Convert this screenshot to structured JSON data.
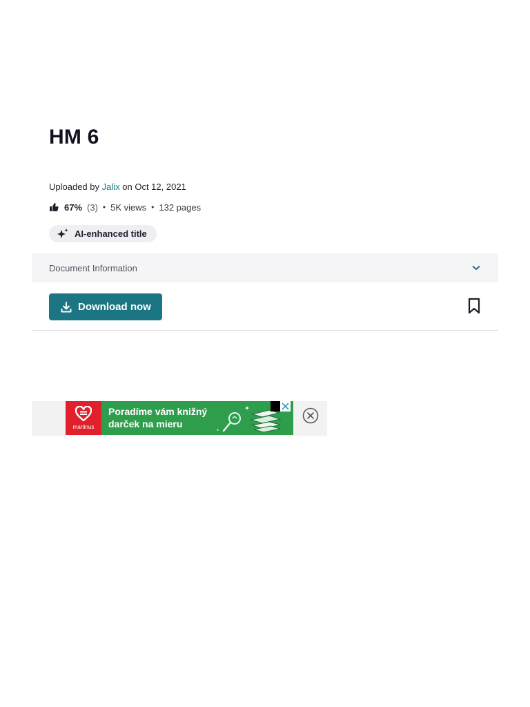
{
  "document": {
    "title": "HM 6",
    "uploaded_prefix": "Uploaded by",
    "author": "Jalix",
    "date_text": "on Oct 12, 2021"
  },
  "stats": {
    "rating_percent": "67%",
    "rating_count": "(3)",
    "separator": "•",
    "views": "5K views",
    "pages": "132 pages"
  },
  "ai_badge": {
    "label": "AI-enhanced title"
  },
  "doc_info": {
    "label": "Document Information"
  },
  "actions": {
    "download_label": "Download now"
  },
  "ad": {
    "brand": "martinus",
    "headline_line1": "Poradíme vám knižný",
    "headline_line2": "darček na mieru"
  },
  "icons": {
    "thumb": "thumbs-up-icon",
    "ai": "sparkle-icon",
    "chevron": "chevron-down-icon",
    "download": "download-icon",
    "bookmark": "bookmark-icon",
    "ad_close": "close-circle-icon"
  },
  "colors": {
    "accent": "#1c7582",
    "author_link": "#1a7c84",
    "ad_green": "#2e9e4d",
    "ad_red": "#e0202c"
  }
}
